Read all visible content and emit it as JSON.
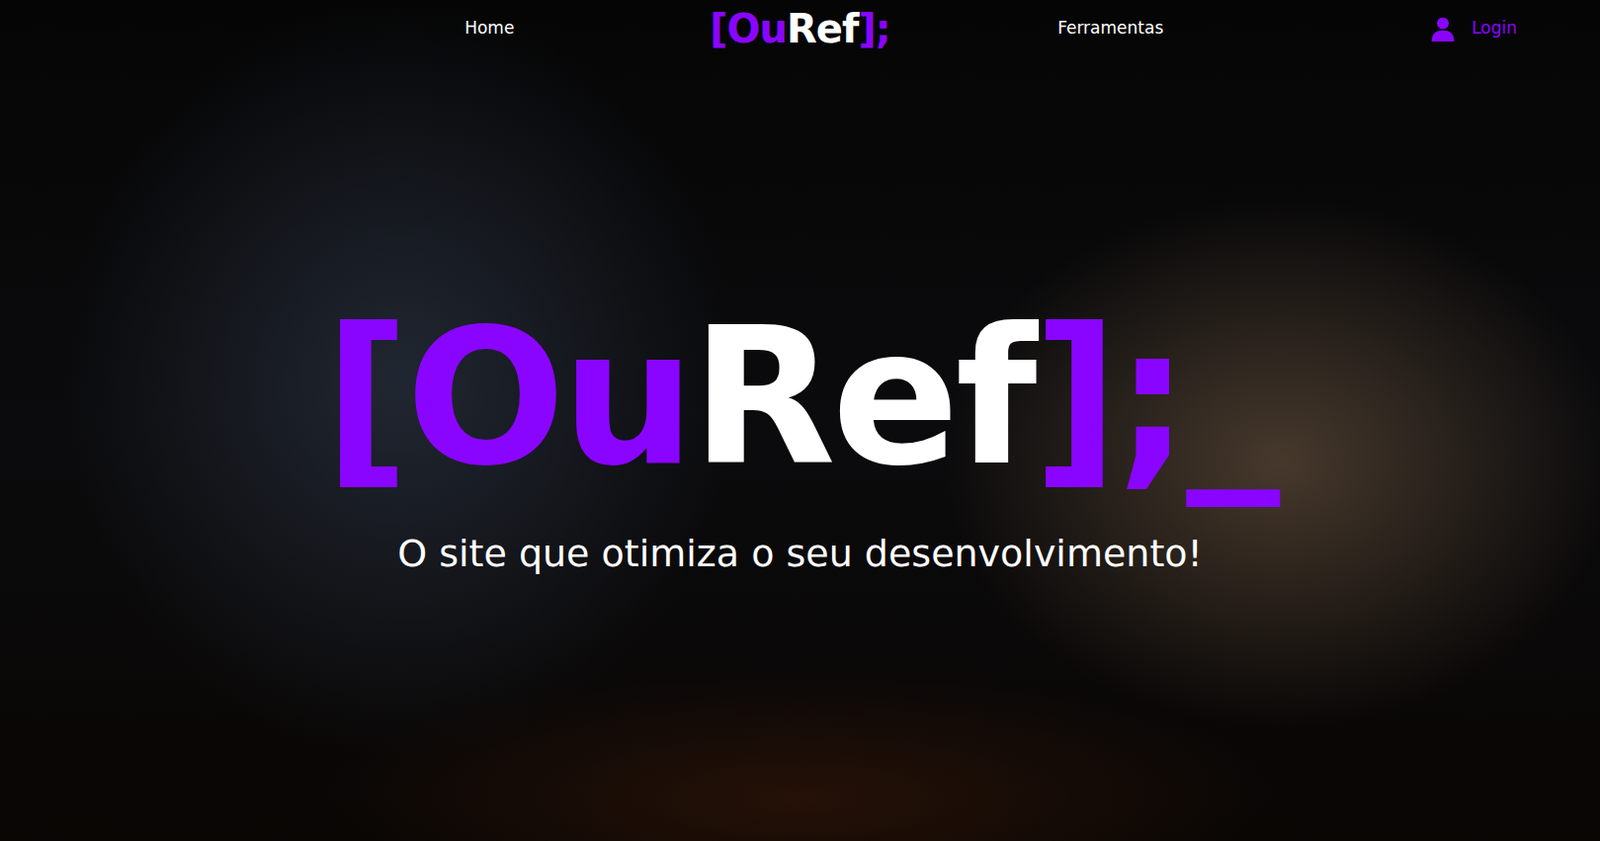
{
  "nav": {
    "links": [
      {
        "label": "Home"
      },
      {
        "label": "Ferramentas"
      }
    ],
    "logo": [
      {
        "text": "[Ou",
        "color": "#8a05ff"
      },
      {
        "text": "Ref",
        "color": "#ffffff"
      },
      {
        "text": "];",
        "color": "#8a05ff"
      }
    ],
    "login": "Login"
  },
  "hero": {
    "logo": [
      {
        "text": "[Ou",
        "color": "#8a05ff"
      },
      {
        "text": "Ref",
        "color": "#ffffff"
      },
      {
        "text": "];",
        "color": "#8a05ff"
      },
      {
        "text": "_",
        "color": "#8a05ff"
      }
    ],
    "tagline": "O site que otimiza o seu desenvolvimento!"
  }
}
